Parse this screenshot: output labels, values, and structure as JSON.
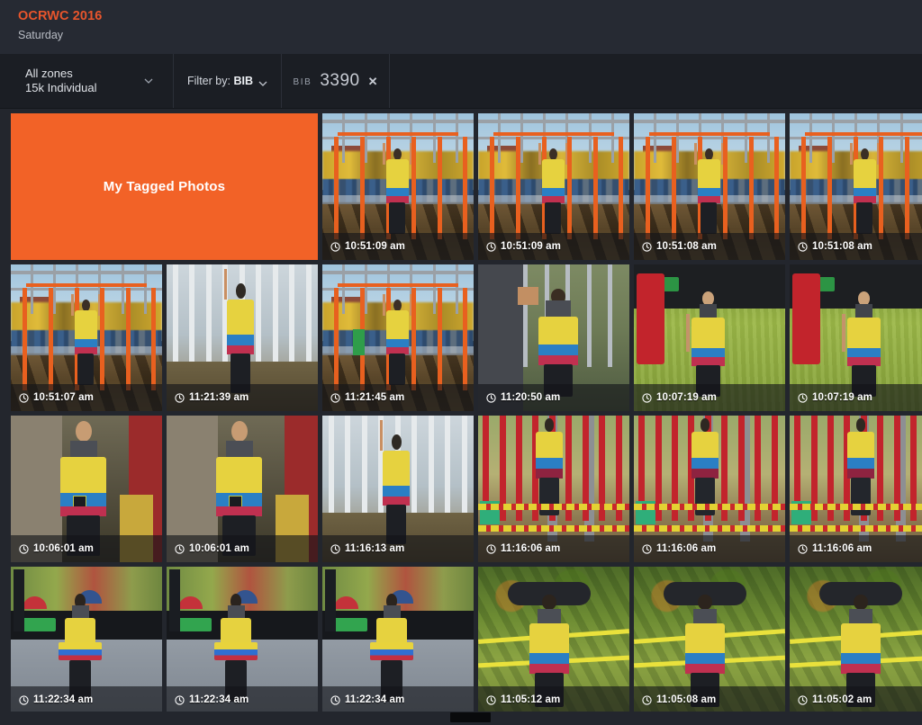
{
  "header": {
    "event_title": "OCRWC 2016",
    "event_day": "Saturday",
    "accent_color": "#e8552c"
  },
  "filter_bar": {
    "zone_selector": {
      "main": "All zones",
      "sub": "15k Individual",
      "icon": "chevron-down-icon"
    },
    "filter_by": {
      "prefix": "Filter by:",
      "value": "BIB",
      "icon": "chevron-down-icon"
    },
    "active_filter": {
      "tag": "BIB",
      "value": "3390",
      "remove_icon": "close-x-icon"
    }
  },
  "grid": {
    "tagged_tile": {
      "label": "My Tagged Photos",
      "color": "#f26227"
    },
    "clock_icon": "clock-icon",
    "photos": [
      {
        "time": "10:51:09 am",
        "scene": "rig"
      },
      {
        "time": "10:51:09 am",
        "scene": "rig"
      },
      {
        "time": "10:51:08 am",
        "scene": "rig"
      },
      {
        "time": "10:51:08 am",
        "scene": "rig"
      },
      {
        "time": "10:51:07 am",
        "scene": "rig-mud"
      },
      {
        "time": "11:21:39 am",
        "scene": "wall"
      },
      {
        "time": "11:21:45 am",
        "scene": "rig-green"
      },
      {
        "time": "11:20:50 am",
        "scene": "platform"
      },
      {
        "time": "10:07:19 am",
        "scene": "grass"
      },
      {
        "time": "10:07:19 am",
        "scene": "grass"
      },
      {
        "time": "10:06:01 am",
        "scene": "crowd-dark"
      },
      {
        "time": "10:06:01 am",
        "scene": "crowd-dark"
      },
      {
        "time": "11:16:13 am",
        "scene": "wall"
      },
      {
        "time": "11:16:06 am",
        "scene": "rope"
      },
      {
        "time": "11:16:06 am",
        "scene": "rope"
      },
      {
        "time": "11:16:06 am",
        "scene": "rope"
      },
      {
        "time": "11:22:34 am",
        "scene": "street"
      },
      {
        "time": "11:22:34 am",
        "scene": "street"
      },
      {
        "time": "11:22:34 am",
        "scene": "street"
      },
      {
        "time": "11:05:12 am",
        "scene": "forest"
      },
      {
        "time": "11:05:08 am",
        "scene": "forest"
      },
      {
        "time": "11:05:02 am",
        "scene": "forest"
      }
    ]
  }
}
